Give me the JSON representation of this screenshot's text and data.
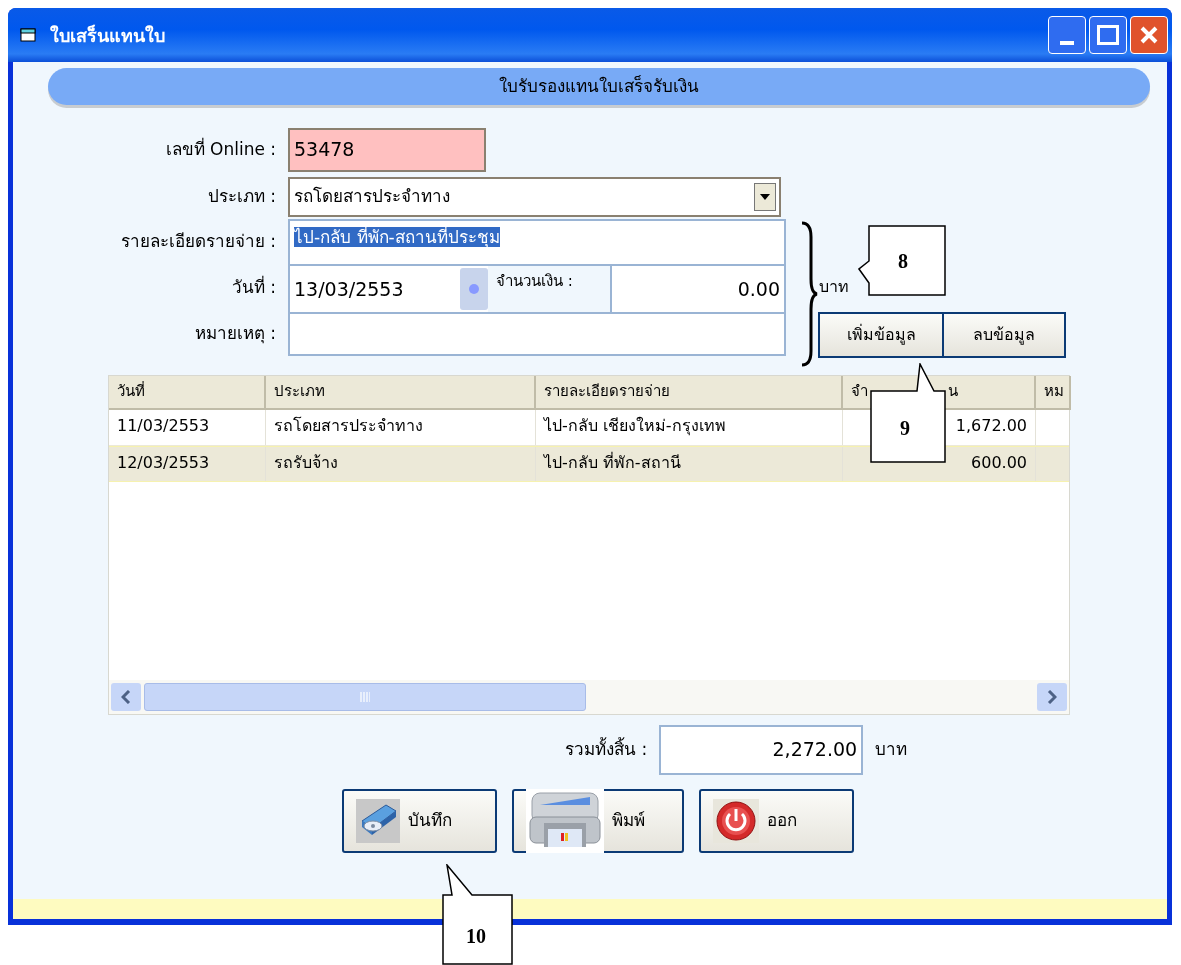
{
  "window": {
    "title": "ใบเสร็นแทนใบ"
  },
  "banner": {
    "title": "ใบรับรองแทนใบเสร็จรับเงิน"
  },
  "form": {
    "online_no": {
      "label": "เลขที่ Online :",
      "value": "53478"
    },
    "type": {
      "label": "ประเภท :",
      "value": "รถโดยสารประจำทาง"
    },
    "detail": {
      "label": "รายละเอียดรายจ่าย :",
      "value": "ไป-กลับ ที่พัก-สถานที่ประชุม",
      "text_selected": true
    },
    "date": {
      "label": "วันที่ :",
      "value": "13/03/2553"
    },
    "amount": {
      "label": "จำนวนเงิน :",
      "value": "0.00",
      "unit": "บาท"
    },
    "note": {
      "label": "หมายเหตุ :"
    }
  },
  "form_buttons": [
    "เพิ่มข้อมูล",
    "ลบข้อมูล"
  ],
  "table": {
    "columns": [
      "วันที่",
      "ประเภท",
      "รายละเอียดรายจ่าย",
      "จำ",
      "หม"
    ],
    "column_4_tail": "น",
    "rows": [
      {
        "date": "11/03/2553",
        "type": "รถโดยสารประจำทาง",
        "detail": "ไป-กลับ เชียงใหม่-กรุงเทพ",
        "amount": "1,672.00",
        "selected": false
      },
      {
        "date": "12/03/2553",
        "type": "รถรับจ้าง",
        "detail": "ไป-กลับ ที่พัก-สถานี",
        "amount": "600.00",
        "selected": true
      }
    ]
  },
  "total": {
    "label": "รวมทั้งสิ้น :",
    "value": "2,272.00",
    "unit": "บาท"
  },
  "actions": [
    {
      "kind": "save",
      "label": "บันทึก"
    },
    {
      "kind": "print",
      "label": "พิมพ์"
    },
    {
      "kind": "exit",
      "label": "ออก"
    }
  ],
  "callouts": [
    "8",
    "9",
    "10"
  ]
}
